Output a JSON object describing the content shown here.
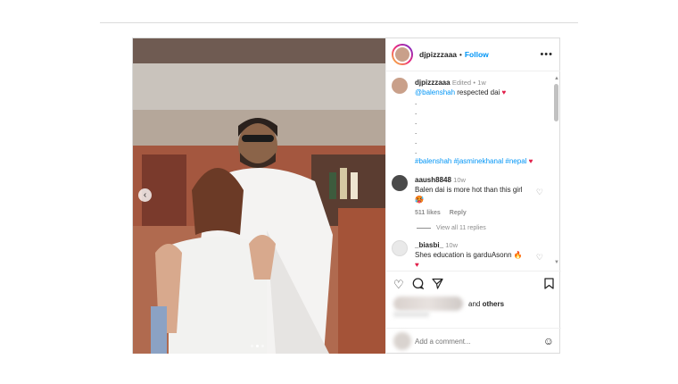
{
  "post": {
    "username": "djpizzzaaa",
    "follow_label": "Follow",
    "more_label": "•••",
    "header_sep": "•"
  },
  "caption": {
    "username": "djpizzzaaa",
    "edited": "Edited",
    "sep": "•",
    "time": "1w",
    "mention": "@balenshah",
    "text": " respected dai",
    "heart": "♥",
    "dots": [
      ".",
      ".",
      ".",
      ".",
      ".",
      "."
    ],
    "hashtags": "#balenshah #jasminekhanal #nepal",
    "hashtag_heart": "♥"
  },
  "comments": [
    {
      "username": "aaush8848",
      "time": "10w",
      "text": "Balen dai is more hot than this girl",
      "emoji": "🥵",
      "likes": "511 likes",
      "reply_label": "Reply",
      "view_replies": "View all 11 replies"
    },
    {
      "username": "_biasbi_",
      "time": "10w",
      "text": "Shes education is garduAsonn",
      "emoji": "🔥",
      "heart": "♥"
    }
  ],
  "actions": {
    "like_icon": "heart-outline",
    "comment_icon": "comment-bubble",
    "share_icon": "paper-plane",
    "save_icon": "bookmark"
  },
  "likes_row": {
    "suffix": "and",
    "others": "others"
  },
  "add_comment": {
    "placeholder": "Add a comment...",
    "emoji_icon": "☺"
  },
  "carousel": {
    "prev_icon": "‹",
    "slide_count": 3,
    "active_index": 1
  },
  "scroll": {
    "up": "▲",
    "down": "▼"
  }
}
